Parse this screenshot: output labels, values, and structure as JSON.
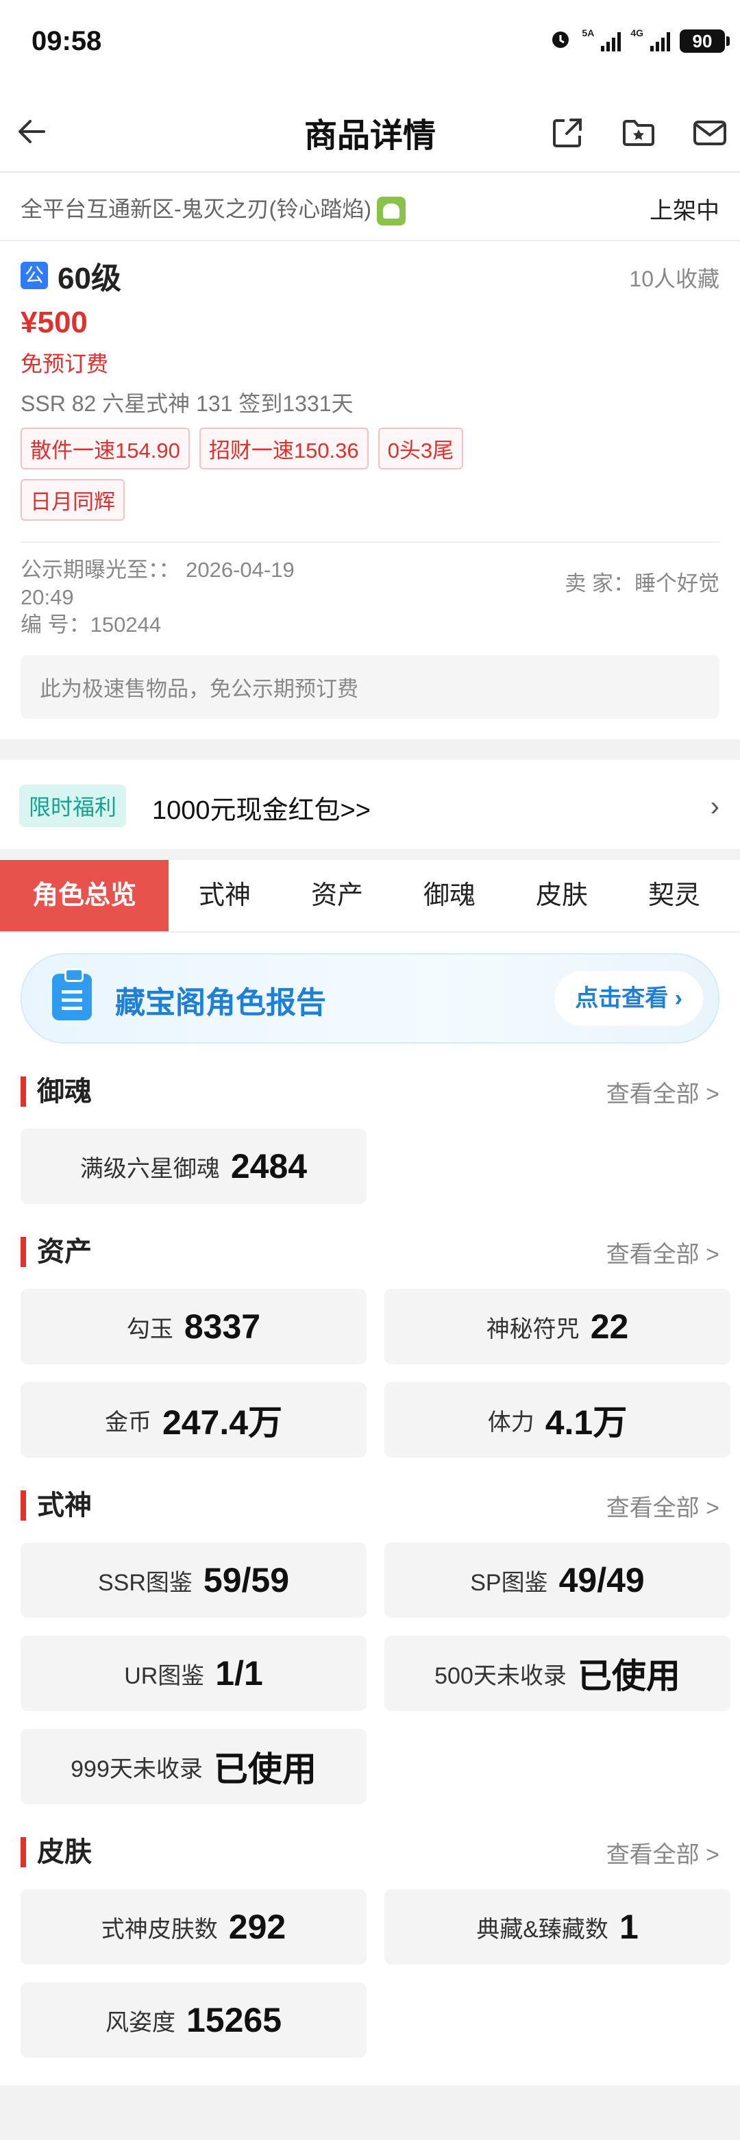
{
  "status": {
    "time": "09:58",
    "net1": "5A",
    "net2": "4G",
    "battery": "90"
  },
  "nav": {
    "title": "商品详情"
  },
  "server": {
    "name": "全平台互通新区-鬼灭之刃(铃心踏焰)",
    "state": "上架中"
  },
  "item": {
    "badge": "公",
    "level": "60级",
    "favorites": "10人收藏",
    "price": "¥500",
    "free_fee": "免预订费",
    "stats": "SSR 82   六星式神 131   签到1331天",
    "tags": [
      "散件一速154.90",
      "招财一速150.36",
      "0头3尾",
      "日月同辉"
    ],
    "publicity_label": "公示期曝光至：",
    "publicity_value": "：  2026-04-19",
    "publicity_time": "20:49",
    "serial_label": "编  号：",
    "serial": "150244",
    "seller_label": "卖  家：",
    "seller": "睡个好觉",
    "notice": "此为极速售物品，免公示期预订费"
  },
  "promo": {
    "badge": "限时福利",
    "text": "1000元现金红包>>",
    "arrow": "›"
  },
  "tabs": [
    "角色总览",
    "式神",
    "资产",
    "御魂",
    "皮肤",
    "契灵"
  ],
  "report": {
    "title": "藏宝阁角色报告",
    "button": "点击查看 ›"
  },
  "sections": [
    {
      "title": "御魂",
      "more": "查看全部 >",
      "cells": [
        {
          "k": "满级六星御魂",
          "v": "2484"
        }
      ]
    },
    {
      "title": "资产",
      "more": "查看全部 >",
      "cells": [
        {
          "k": "勾玉",
          "v": "8337"
        },
        {
          "k": "神秘符咒",
          "v": "22"
        },
        {
          "k": "金币",
          "v": "247.4万"
        },
        {
          "k": "体力",
          "v": "4.1万"
        }
      ]
    },
    {
      "title": "式神",
      "more": "查看全部 >",
      "cells": [
        {
          "k": "SSR图鉴",
          "v": "59/59"
        },
        {
          "k": "SP图鉴",
          "v": "49/49"
        },
        {
          "k": "UR图鉴",
          "v": "1/1"
        },
        {
          "k": "500天未收录",
          "v": "已使用"
        },
        {
          "k": "999天未收录",
          "v": "已使用"
        }
      ]
    },
    {
      "title": "皮肤",
      "more": "查看全部 >",
      "cells": [
        {
          "k": "式神皮肤数",
          "v": "292"
        },
        {
          "k": "典藏&臻藏数",
          "v": "1"
        },
        {
          "k": "风姿度",
          "v": "15265"
        }
      ]
    }
  ]
}
